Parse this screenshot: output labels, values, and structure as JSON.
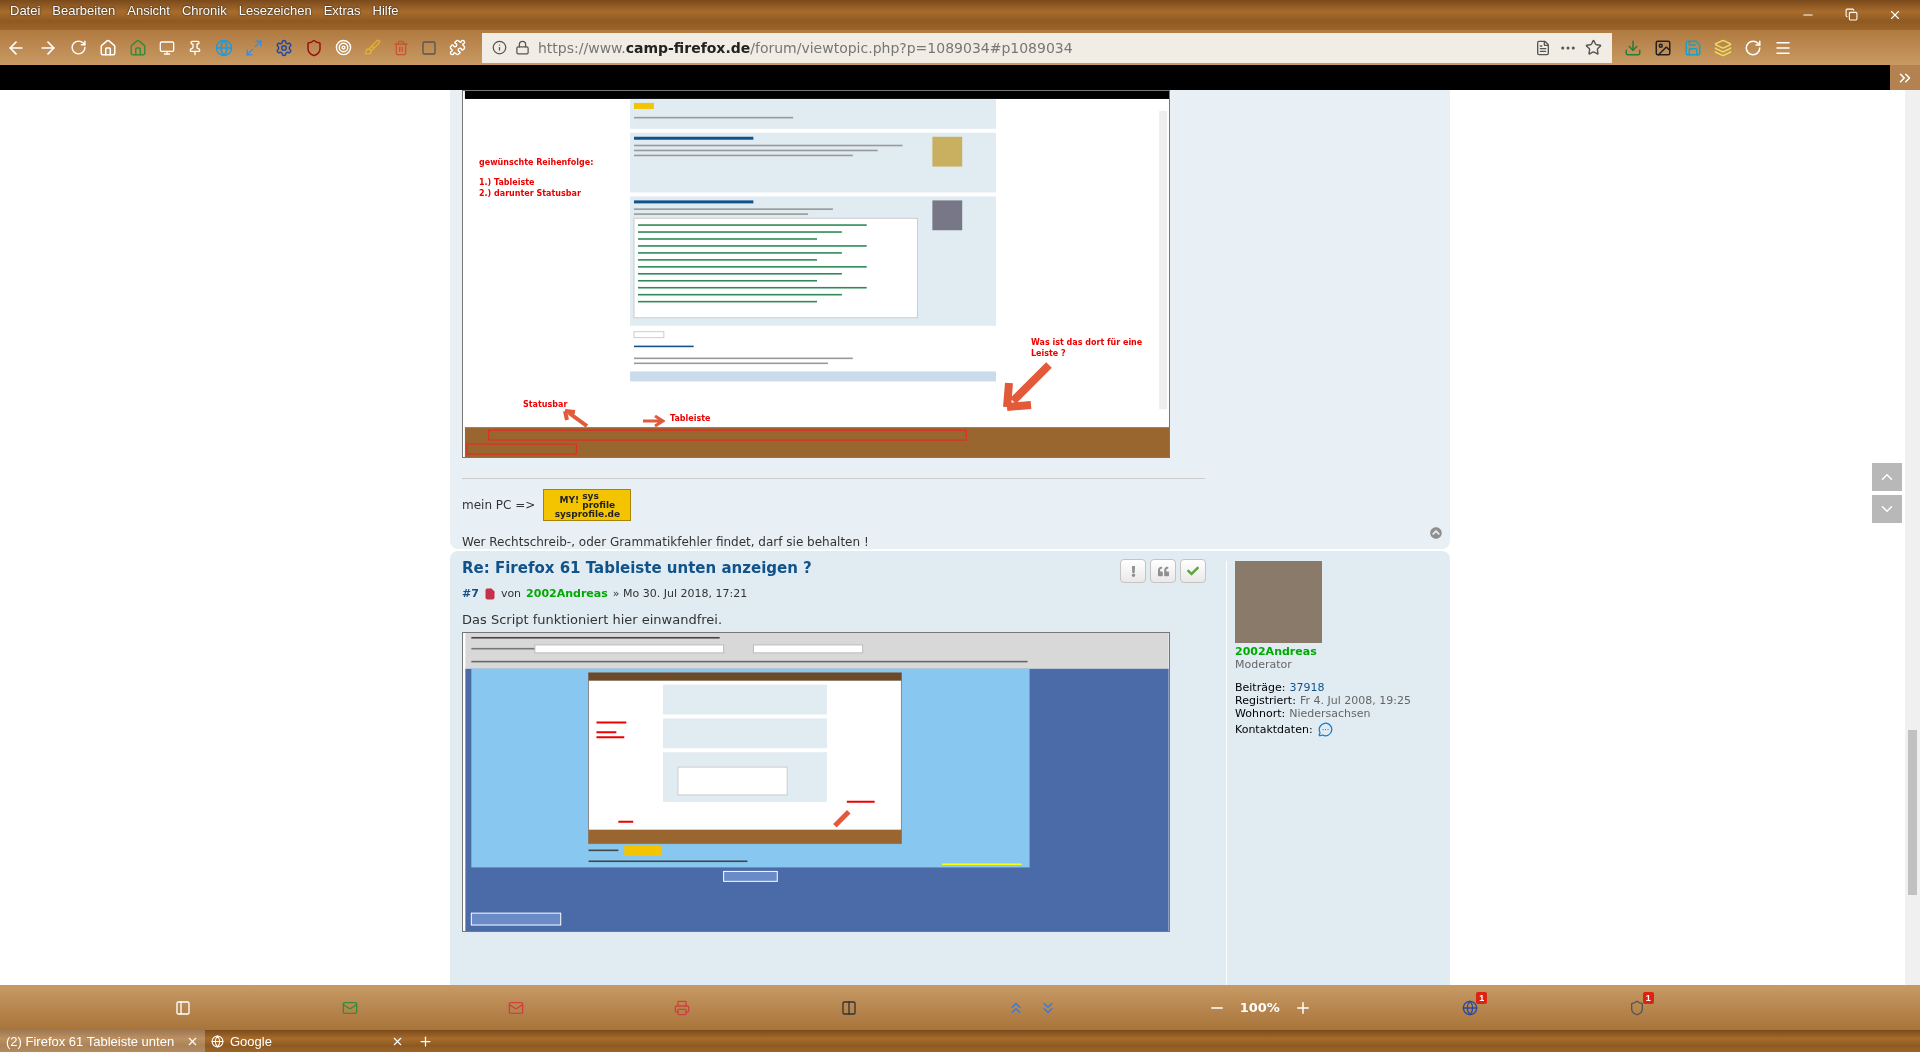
{
  "menu_bar": {
    "items": [
      "Datei",
      "Bearbeiten",
      "Ansicht",
      "Chronik",
      "Lesezeichen",
      "Extras",
      "Hilfe"
    ]
  },
  "address_bar": {
    "url": "https://www.**camp-firefox.de**/forum/viewtopic.php?p=1089034#p1089034"
  },
  "posts": [
    {
      "kind": "partial",
      "annotations": {
        "order_title": "gewünschte Reihenfolge:",
        "order_1": "1.) Tableiste",
        "order_2": "2.) darunter Statusbar",
        "statusbar": "Statusbar",
        "tabbar": "Tableiste",
        "question": "Was ist das dort für eine Leiste ?"
      },
      "signature_label": "mein PC =>",
      "logo": {
        "mark": "MY!",
        "top": "sys",
        "bottom": "profile",
        "site": "sysprofile.de"
      },
      "signature_text": "Wer Rechtschreib-, oder Grammatikfehler findet, darf sie behalten !"
    },
    {
      "kind": "full",
      "title": "Re: Firefox 61 Tableiste unten anzeigen ?",
      "number": "#7",
      "by": "von",
      "author": "2002Andreas",
      "date": "» Mo 30. Jul 2018, 17:21",
      "body": "Das Script funktioniert hier einwandfrei.",
      "profile": {
        "name": "2002Andreas",
        "rank": "Moderator",
        "stats": [
          {
            "label": "Beiträge:",
            "value": "37918"
          },
          {
            "label": "Registriert:",
            "value": "Fr 4. Jul 2008, 19:25"
          },
          {
            "label": "Wohnort:",
            "value": "Niedersachsen"
          }
        ],
        "contact_label": "Kontaktdaten:"
      }
    }
  ],
  "status_bar": {
    "zoom": "100%",
    "badges": [
      "1",
      "1"
    ]
  },
  "tabs": [
    {
      "label": "(2) Firefox 61 Tableiste unten",
      "selected": true
    },
    {
      "label": "Google",
      "selected": false
    }
  ]
}
